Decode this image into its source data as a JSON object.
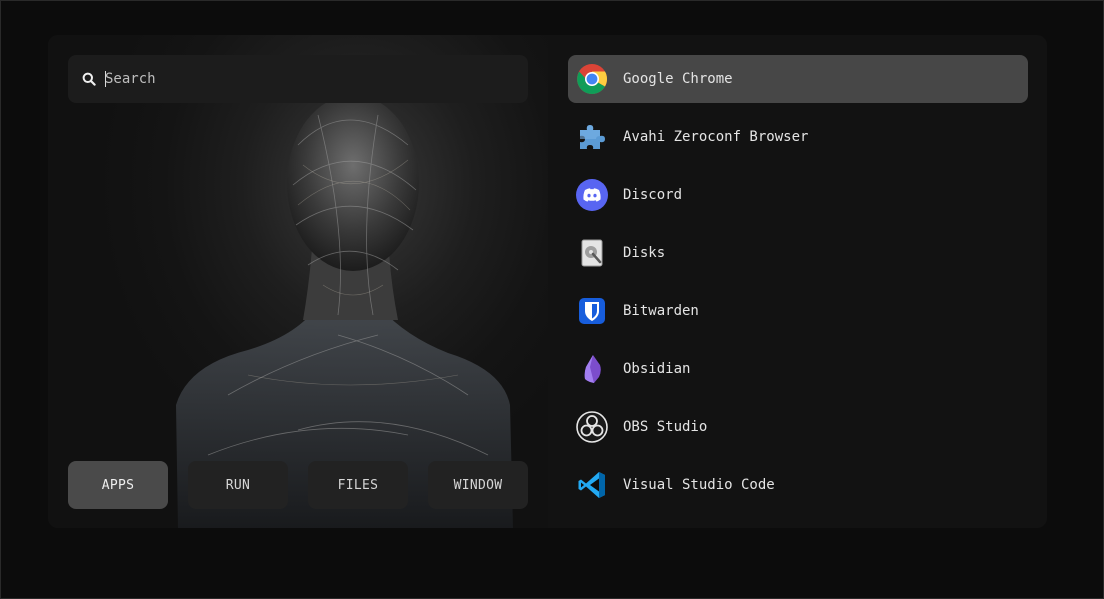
{
  "search": {
    "placeholder": "Search",
    "value": ""
  },
  "modes": [
    {
      "label": "APPS",
      "active": true
    },
    {
      "label": "RUN",
      "active": false
    },
    {
      "label": "FILES",
      "active": false
    },
    {
      "label": "WINDOW",
      "active": false
    }
  ],
  "apps": [
    {
      "name": "Google Chrome",
      "icon": "chrome-icon",
      "selected": true
    },
    {
      "name": "Avahi Zeroconf Browser",
      "icon": "puzzle-icon",
      "selected": false
    },
    {
      "name": "Discord",
      "icon": "discord-icon",
      "selected": false
    },
    {
      "name": "Disks",
      "icon": "disks-icon",
      "selected": false
    },
    {
      "name": "Bitwarden",
      "icon": "bitwarden-icon",
      "selected": false
    },
    {
      "name": "Obsidian",
      "icon": "obsidian-icon",
      "selected": false
    },
    {
      "name": "OBS Studio",
      "icon": "obs-icon",
      "selected": false
    },
    {
      "name": "Visual Studio Code",
      "icon": "vscode-icon",
      "selected": false
    }
  ],
  "colors": {
    "background": "#0c0c0c",
    "panel": "#121212",
    "selected": "#474747",
    "text": "#e4e4e4"
  }
}
